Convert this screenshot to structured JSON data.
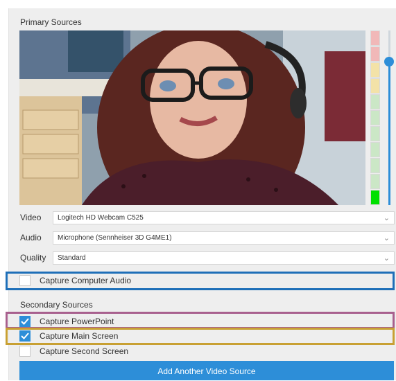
{
  "primary": {
    "title": "Primary Sources",
    "vu_levels": [
      "#f1b8b8",
      "#f1b8b8",
      "#f3e2a8",
      "#f3e2a8",
      "#cbe7c6",
      "#cbe7c6",
      "#cbe7c6",
      "#cbe7c6",
      "#cbe7c6",
      "#cbe7c6",
      "#00e000"
    ],
    "volume_level": 0.82,
    "fields": [
      {
        "label": "Video",
        "value": "Logitech HD Webcam C525"
      },
      {
        "label": "Audio",
        "value": "Microphone (Sennheiser 3D G4ME1)"
      },
      {
        "label": "Quality",
        "value": "Standard"
      }
    ],
    "capture_audio": {
      "label": "Capture Computer Audio",
      "checked": false
    }
  },
  "secondary": {
    "title": "Secondary Sources",
    "items": [
      {
        "label": "Capture PowerPoint",
        "checked": true
      },
      {
        "label": "Capture Main Screen",
        "checked": true
      },
      {
        "label": "Capture Second Screen",
        "checked": false
      }
    ],
    "add_button": "Add Another Video Source"
  },
  "highlight_colors": {
    "audio": "#1e6fb8",
    "powerpoint": "#a8608e",
    "main_screen": "#c8a033"
  },
  "accent": "#2d8ed8",
  "icons": {
    "dropdown": "chevron-down-icon",
    "check": "checkmark-icon"
  }
}
